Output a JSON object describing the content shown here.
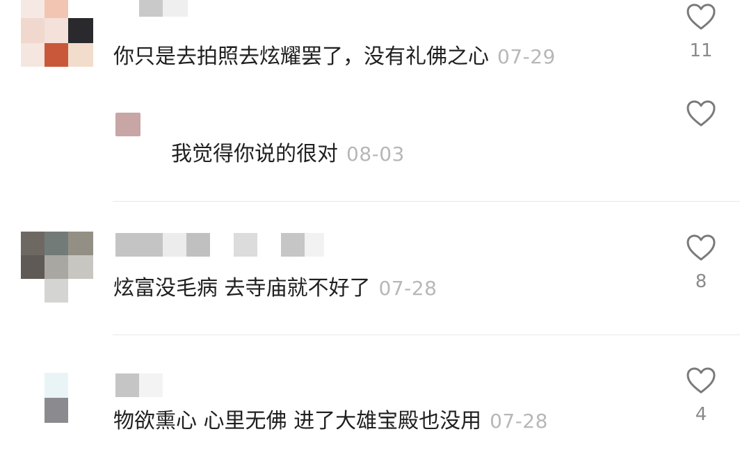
{
  "comments": [
    {
      "text": "你只是去拍照去炫耀罢了，没有礼佛之心",
      "date": "07-29",
      "likes": "11",
      "is_reply": false
    },
    {
      "text": "我觉得你说的很对",
      "date": "08-03",
      "likes": "",
      "is_reply": true
    },
    {
      "text": "炫富没毛病 去寺庙就不好了",
      "date": "07-28",
      "likes": "8",
      "is_reply": false
    },
    {
      "text": "物欲熏心 心里无佛 进了大雄宝殿也没用",
      "date": "07-28",
      "likes": "4",
      "is_reply": false
    }
  ],
  "icons": {
    "like": "heart-outline-icon"
  },
  "colors": {
    "text": "#202020",
    "date": "#b7b7b7",
    "count": "#8a8a8a",
    "divider": "#e8e8e8"
  }
}
